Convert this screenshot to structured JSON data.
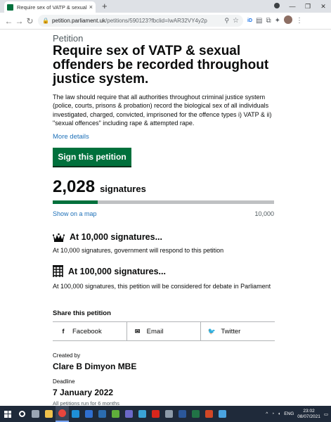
{
  "browser": {
    "tab_title": "Require sex of VATP & sexual offe",
    "tab_close": "×",
    "new_tab": "+",
    "url_host": "petition.parliament.uk",
    "url_path": "/petitions/590123?fbclid=IwAR32VY4y2p",
    "id_badge": "iD"
  },
  "petition": {
    "caption": "Petition",
    "title": "Require sex of VATP & sexual offenders be recorded throughout justice system.",
    "body": "The law should require that all authorities throughout criminal justice system (police, courts, prisons & probation) record the biological sex of all individuals investigated, charged, convicted, imprisoned for the offence types i) VATP & ii) \"sexual offences\" including rape & attempted rape.",
    "more_details": "More details",
    "sign_button": "Sign this petition"
  },
  "signatures": {
    "count": "2,028",
    "label": "signatures",
    "show_on_map": "Show on a map",
    "target": "10,000",
    "progress_fraction": 0.2028
  },
  "milestones": [
    {
      "heading": "At 10,000 signatures...",
      "text": "At 10,000 signatures, government will respond to this petition"
    },
    {
      "heading": "At 100,000 signatures...",
      "text": "At 100,000 signatures, this petition will be considered for debate in Parliament"
    }
  ],
  "share": {
    "heading": "Share this petition",
    "items": [
      {
        "label": "Facebook",
        "icon": "facebook-icon",
        "glyph": "f"
      },
      {
        "label": "Email",
        "icon": "email-icon",
        "glyph": "✉"
      },
      {
        "label": "Twitter",
        "icon": "twitter-icon",
        "glyph": "🐦"
      }
    ]
  },
  "meta": {
    "created_label": "Created by",
    "created_value": "Clare B Dimyon MBE",
    "deadline_label": "Deadline",
    "deadline_value": "7 January 2022",
    "note": "All petitions run for 6 months"
  },
  "taskbar": {
    "language": "ENG",
    "time": "23:02",
    "date": "08/07/2021",
    "apps": [
      {
        "icon": "search-icon",
        "color": "#ffffff"
      },
      {
        "icon": "task-view-icon",
        "color": "#9aa5b4"
      },
      {
        "icon": "file-explorer-icon",
        "color": "#f0c14b"
      },
      {
        "icon": "chrome-icon",
        "color": "#e8453c"
      },
      {
        "icon": "edge-icon",
        "color": "#1e8fd6"
      },
      {
        "icon": "mail-icon",
        "color": "#2f6fd1"
      },
      {
        "icon": "store-icon",
        "color": "#2b6cb0"
      },
      {
        "icon": "green-app-icon",
        "color": "#5fae3b"
      },
      {
        "icon": "teams-icon",
        "color": "#6b68c9"
      },
      {
        "icon": "photos-icon",
        "color": "#3aa3d6"
      },
      {
        "icon": "acrobat-icon",
        "color": "#d9261c"
      },
      {
        "icon": "network-icon",
        "color": "#8d9ba9"
      },
      {
        "icon": "word-icon",
        "color": "#2b579a"
      },
      {
        "icon": "excel-icon",
        "color": "#217346"
      },
      {
        "icon": "powerpoint-icon",
        "color": "#d24726"
      },
      {
        "icon": "snip-icon",
        "color": "#4aa3df"
      }
    ]
  },
  "colors": {
    "govuk_green": "#00703c",
    "link_blue": "#1d70b8",
    "progress_track": "#bfc1c3",
    "taskbar": "#1f2a3a"
  }
}
